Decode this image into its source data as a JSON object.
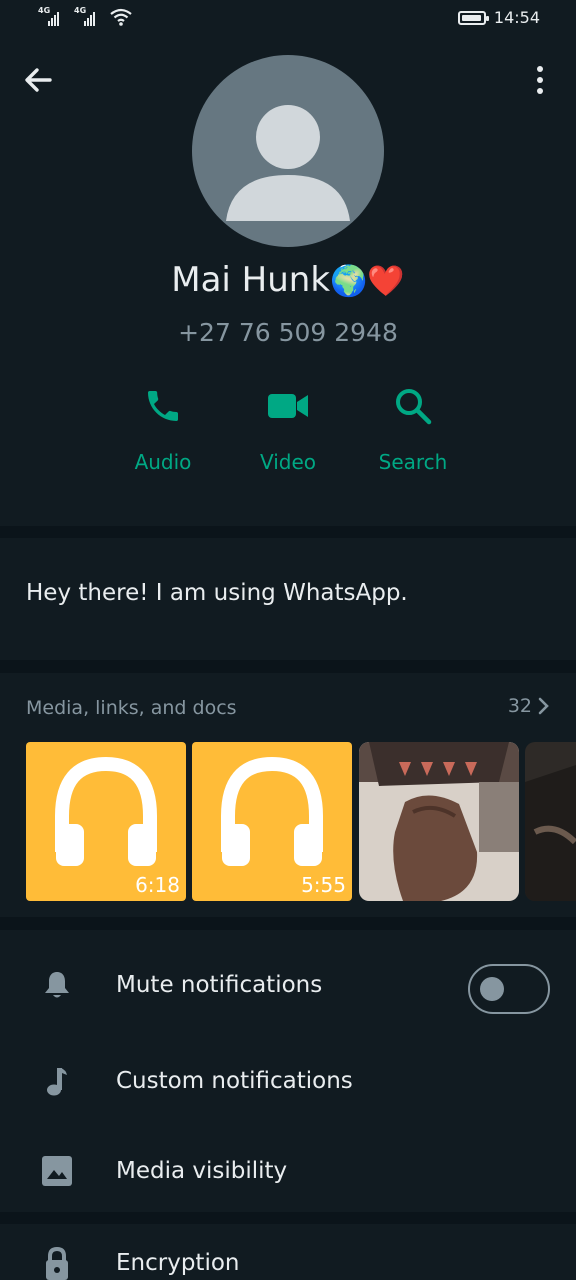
{
  "status_bar": {
    "time": "14:54",
    "network_1": "4G",
    "network_2": "4G"
  },
  "contact": {
    "name": "Mai Hunk",
    "name_emoji": "🌍❤️",
    "phone": "+27 76 509 2948"
  },
  "actions": [
    {
      "label": "Audio",
      "icon": "phone-icon"
    },
    {
      "label": "Video",
      "icon": "video-icon"
    },
    {
      "label": "Search",
      "icon": "search-icon"
    }
  ],
  "about": {
    "text": "Hey there! I am using WhatsApp."
  },
  "media": {
    "header": "Media, links, and docs",
    "count": "32",
    "items": [
      {
        "type": "audio",
        "duration": "6:18"
      },
      {
        "type": "audio",
        "duration": "5:55"
      },
      {
        "type": "photo",
        "duration": ""
      },
      {
        "type": "photo",
        "duration": ""
      }
    ]
  },
  "settings": {
    "mute": {
      "label": "Mute notifications",
      "icon": "bell-icon",
      "toggle_on": false
    },
    "custom": {
      "label": "Custom notifications",
      "icon": "music-note-icon"
    },
    "visibility": {
      "label": "Media visibility",
      "icon": "image-icon"
    },
    "encryption": {
      "label": "Encryption",
      "icon": "lock-icon"
    }
  },
  "colors": {
    "accent": "#00a884",
    "background": "#0b141a",
    "panel": "#111b21",
    "secondary_text": "#8696a0",
    "audio_tile": "#ffbc38"
  }
}
